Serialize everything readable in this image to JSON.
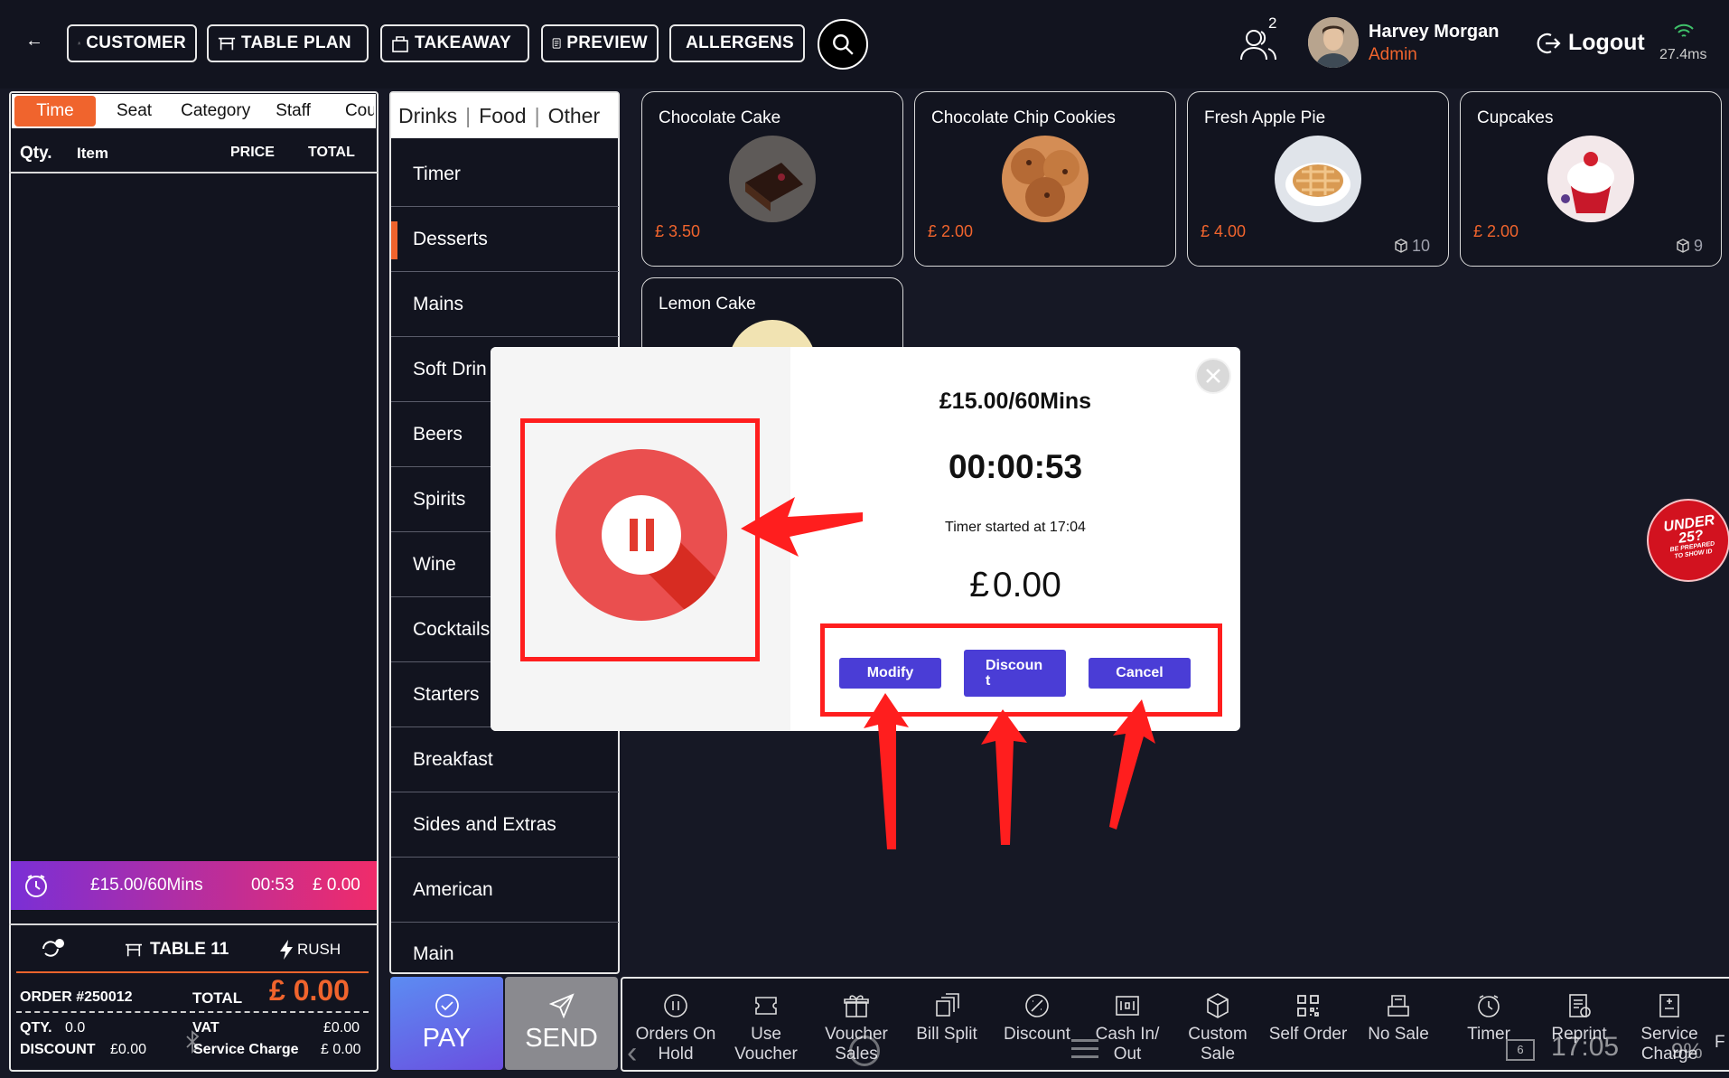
{
  "header": {
    "back": "←",
    "buttons": [
      "CUSTOMER",
      "TABLE PLAN",
      "TAKEAWAY",
      "PREVIEW",
      "ALLERGENS"
    ],
    "users_count": "2",
    "user_name": "Harvey Morgan",
    "user_role": "Admin",
    "logout": "Logout",
    "latency": "27.4ms"
  },
  "order_panel": {
    "tabs": [
      "Time",
      "Seat",
      "Category",
      "Staff",
      "Cou"
    ],
    "columns": {
      "qty": "Qty.",
      "item": "Item",
      "price": "PRICE",
      "total": "TOTAL"
    },
    "timer_bar": {
      "rate": "£15.00/60Mins",
      "elapsed": "00:53",
      "amount": "£ 0.00"
    },
    "table": "TABLE 11",
    "rush": "RUSH",
    "order_no": "ORDER #250012",
    "total_label": "TOTAL",
    "total_value": "£ 0.00",
    "qty_label": "QTY.",
    "qty_value": "0.0",
    "vat_label": "VAT",
    "vat_value": "£0.00",
    "discount_label": "DISCOUNT",
    "discount_value": "£0.00",
    "service_label": "Service Charge",
    "service_value": "£ 0.00"
  },
  "categories": {
    "tabs": [
      "Drinks",
      "Food",
      "Other"
    ],
    "items": [
      "Timer",
      "Desserts",
      "Mains",
      "Soft Drin",
      "Beers",
      "Spirits",
      "Wine",
      "Cocktails",
      "Starters",
      "Breakfast",
      "Sides and Extras",
      "American",
      "Main"
    ],
    "active": "Desserts"
  },
  "products": [
    {
      "name": "Chocolate Cake",
      "price": "£ 3.50",
      "stock": ""
    },
    {
      "name": "Chocolate Chip Cookies",
      "price": "£ 2.00",
      "stock": ""
    },
    {
      "name": "Fresh Apple Pie",
      "price": "£ 4.00",
      "stock": "10"
    },
    {
      "name": "Cupcakes",
      "price": "£ 2.00",
      "stock": "9"
    },
    {
      "name": "Lemon Cake",
      "price": "",
      "stock": ""
    }
  ],
  "modal": {
    "rate": "£15.00/60Mins",
    "elapsed": "00:00:53",
    "started": "Timer started at 17:04",
    "amount_symbol": "£",
    "amount": "0.00",
    "buttons": {
      "modify": "Modify",
      "discount_1": "Discoun",
      "discount_2": "t",
      "cancel": "Cancel"
    }
  },
  "actions": {
    "pay": "PAY",
    "send": "SEND",
    "toolbar": [
      {
        "l1": "Orders On",
        "l2": "Hold",
        "icon": "pause-circle-icon"
      },
      {
        "l1": "Use",
        "l2": "Voucher",
        "icon": "voucher-icon"
      },
      {
        "l1": "Voucher",
        "l2": "Sales",
        "icon": "gift-icon"
      },
      {
        "l1": "Bill Split",
        "l2": "",
        "icon": "bill-split-icon"
      },
      {
        "l1": "Discount",
        "l2": "",
        "icon": "discount-icon"
      },
      {
        "l1": "Cash In/",
        "l2": "Out",
        "icon": "cash-icon"
      },
      {
        "l1": "Custom",
        "l2": "Sale",
        "icon": "box-icon"
      },
      {
        "l1": "Self Order",
        "l2": "",
        "icon": "qr-icon"
      },
      {
        "l1": "No Sale",
        "l2": "",
        "icon": "register-icon"
      },
      {
        "l1": "Timer",
        "l2": "",
        "icon": "timer-icon"
      },
      {
        "l1": "Reprint",
        "l2": "",
        "icon": "reprint-icon"
      },
      {
        "l1": "Service",
        "l2": "Charge",
        "icon": "service-icon"
      },
      {
        "l1": "F",
        "l2": "",
        "icon": ""
      }
    ]
  },
  "status": {
    "time": "17:05",
    "battery": "9%",
    "notif": "6"
  },
  "badge": {
    "l1": "UNDER",
    "l2": "25?",
    "l3": "BE PREPARED",
    "l4": "TO SHOW ID"
  },
  "colors": {
    "accent": "#f0642d",
    "bg": "#161825",
    "modal_btn": "#4a3dd6",
    "annotation": "#ff1e1e"
  }
}
